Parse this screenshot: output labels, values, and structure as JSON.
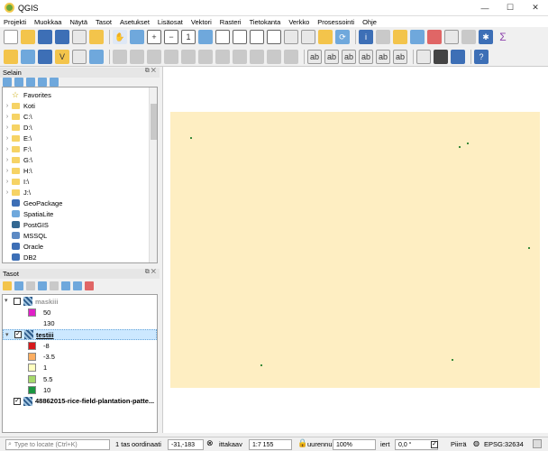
{
  "window": {
    "title": "QGIS"
  },
  "menubar": [
    "Projekti",
    "Muokkaa",
    "Näytä",
    "Tasot",
    "Asetukset",
    "Lisäosat",
    "Vektori",
    "Rasteri",
    "Tietokanta",
    "Verkko",
    "Prosessointi",
    "Ohje"
  ],
  "browser_panel": {
    "title": "Selain",
    "items": [
      {
        "label": "Favorites",
        "icon": "star-icon"
      },
      {
        "label": "Koti",
        "icon": "folder-icon"
      },
      {
        "label": "C:\\",
        "icon": "folder-icon"
      },
      {
        "label": "D:\\",
        "icon": "folder-icon"
      },
      {
        "label": "E:\\",
        "icon": "folder-icon"
      },
      {
        "label": "F:\\",
        "icon": "folder-icon"
      },
      {
        "label": "G:\\",
        "icon": "folder-icon"
      },
      {
        "label": "H:\\",
        "icon": "folder-icon"
      },
      {
        "label": "I:\\",
        "icon": "folder-icon"
      },
      {
        "label": "J:\\",
        "icon": "folder-icon"
      },
      {
        "label": "GeoPackage",
        "icon": "geopackage-icon"
      },
      {
        "label": "SpatiaLite",
        "icon": "spatialite-icon"
      },
      {
        "label": "PostGIS",
        "icon": "postgis-icon"
      },
      {
        "label": "MSSQL",
        "icon": "mssql-icon"
      },
      {
        "label": "Oracle",
        "icon": "oracle-icon"
      },
      {
        "label": "DB2",
        "icon": "db2-icon"
      }
    ]
  },
  "layers_panel": {
    "title": "Tasot",
    "layers": [
      {
        "name": "maskiii",
        "checked": false,
        "greyed": true,
        "legend": [
          {
            "label": "50",
            "color": "#e020c8"
          },
          {
            "label": "130",
            "color": "#ffffff"
          }
        ]
      },
      {
        "name": "testiii",
        "checked": true,
        "selected": true,
        "legend": [
          {
            "label": "-8",
            "color": "#d7191c"
          },
          {
            "label": "-3.5",
            "color": "#fdae61"
          },
          {
            "label": "1",
            "color": "#ffffbf"
          },
          {
            "label": "5.5",
            "color": "#a6d96a"
          },
          {
            "label": "10",
            "color": "#1a9641"
          }
        ]
      },
      {
        "name": "48862015-rice-field-plantation-patte...",
        "checked": true,
        "legend": []
      }
    ]
  },
  "statusbar": {
    "locator_placeholder": "Type to locate (Ctrl+K)",
    "task_label": "1 tas",
    "coord_label": "oordinaati",
    "coord_value": "-31,-183",
    "scale_label": "ittakaav",
    "scale_value": "1:7 155",
    "magnifier_label": "uurennu",
    "magnifier_value": "100%",
    "rotation_label": "iert",
    "rotation_value": "0,0 °",
    "render_label": "Piirrä",
    "crs_label": "EPSG:32634"
  },
  "colors": {
    "raster_fill": "#feeec2",
    "selection": "#cce8ff"
  }
}
